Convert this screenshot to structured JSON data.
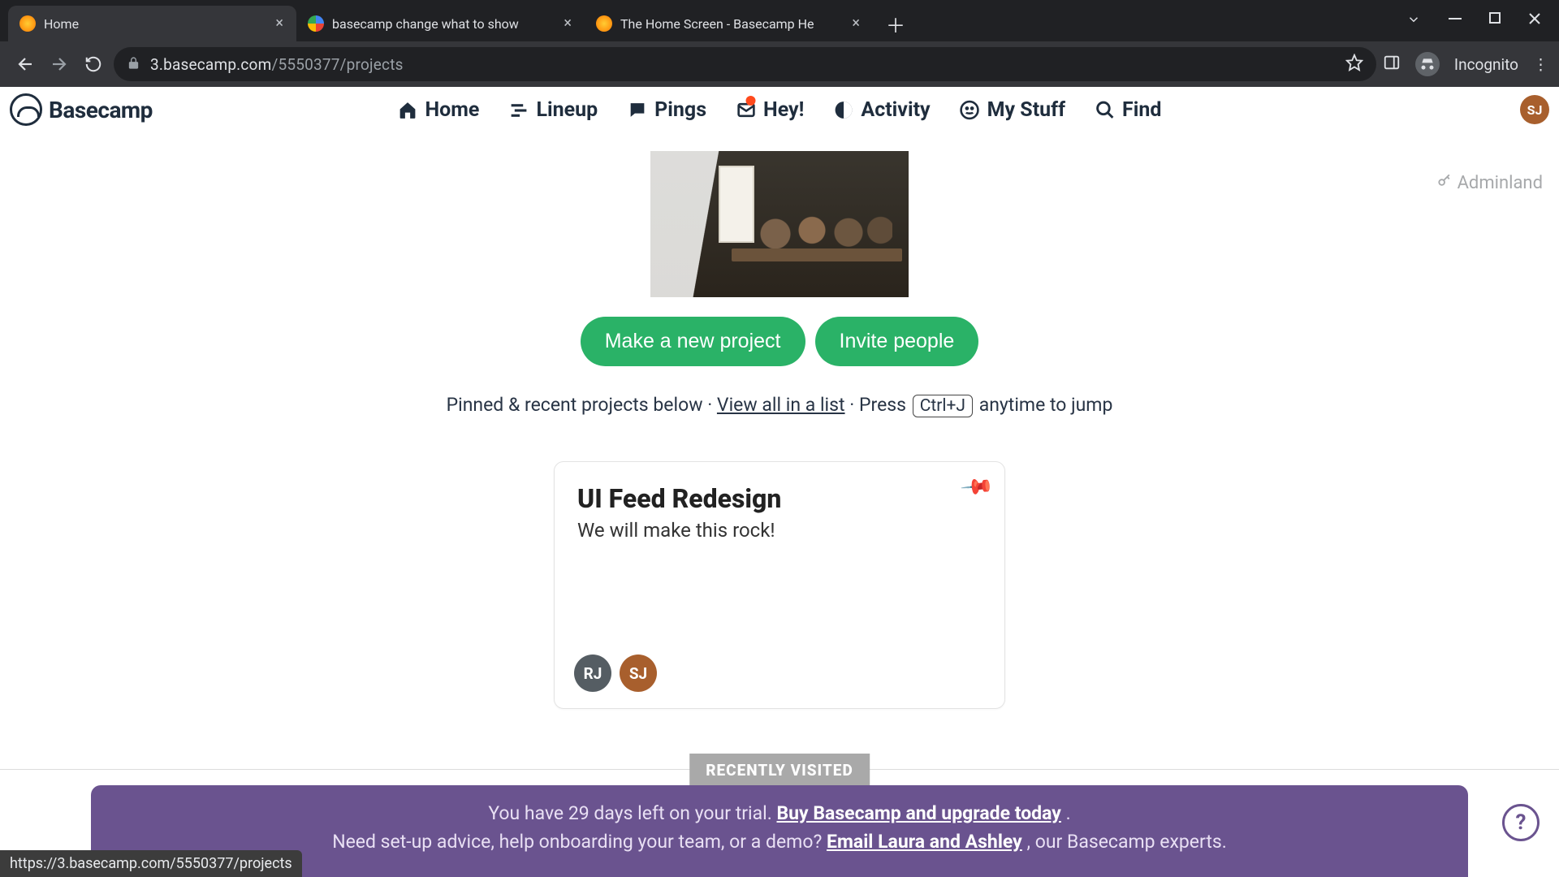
{
  "browser": {
    "tabs": [
      {
        "title": "Home"
      },
      {
        "title": "basecamp change what to show"
      },
      {
        "title": "The Home Screen - Basecamp He"
      }
    ],
    "url_host": "3.basecamp.com",
    "url_path": "/5550377/projects",
    "incognito_label": "Incognito"
  },
  "nav": {
    "home": "Home",
    "lineup": "Lineup",
    "pings": "Pings",
    "hey": "Hey!",
    "activity": "Activity",
    "mystuff": "My Stuff",
    "find": "Find",
    "logo_text": "Basecamp",
    "avatar": "SJ"
  },
  "adminland": "Adminland",
  "cta": {
    "new_project": "Make a new project",
    "invite": "Invite people"
  },
  "helper": {
    "prefix": "Pinned & recent projects below · ",
    "view_all": "View all in a list",
    "press": " · Press ",
    "kbd": "Ctrl+J",
    "suffix": " anytime to jump"
  },
  "project": {
    "title": "UI Feed Redesign",
    "desc": "We will make this rock!",
    "avatars": [
      "RJ",
      "SJ"
    ]
  },
  "recent_label": "RECENTLY VISITED",
  "trial": {
    "line1_a": "You have 29 days left on your trial. ",
    "line1_link": "Buy Basecamp and upgrade today",
    "line1_b": ".",
    "line2_a": "Need set-up advice, help onboarding your team, or a demo? ",
    "line2_link": "Email Laura and Ashley",
    "line2_b": ", our Basecamp experts."
  },
  "status_url": "https://3.basecamp.com/5550377/projects"
}
